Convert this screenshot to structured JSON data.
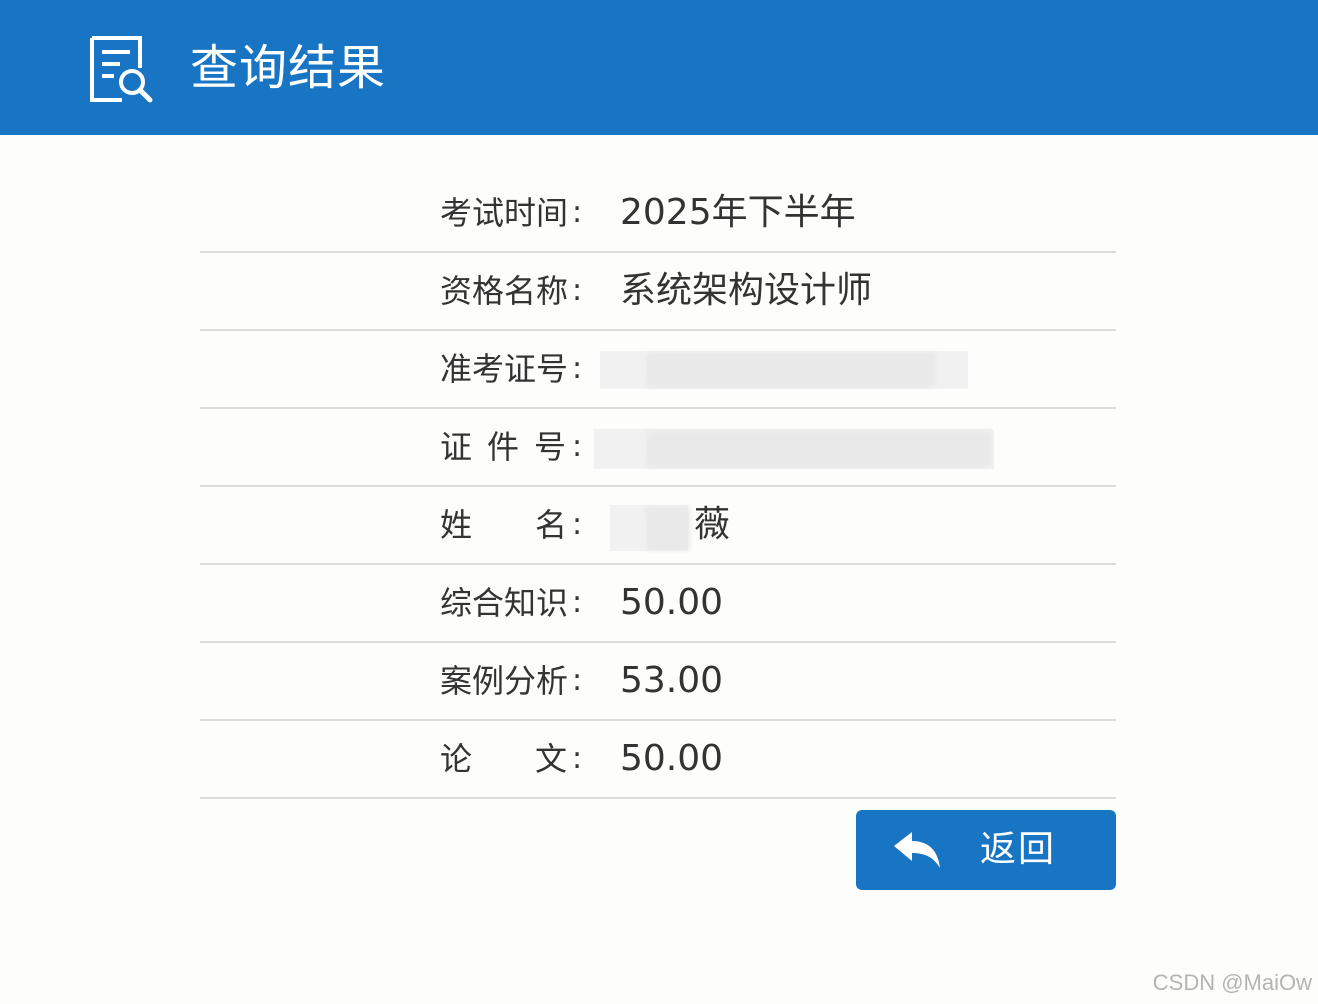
{
  "header": {
    "title": "查询结果",
    "icon": "document-search-icon",
    "bg_color": "#1875c4"
  },
  "results": [
    {
      "label": "考试时间",
      "colon": ":",
      "value": "2025年下半年"
    },
    {
      "label": "资格名称",
      "colon": ":",
      "value": "系统架构设计师"
    },
    {
      "label": "准考证号",
      "colon": ":",
      "value": ""
    },
    {
      "label": "证件号",
      "colon": ":",
      "value": ""
    },
    {
      "label": "姓名",
      "colon": ":",
      "value": "薇"
    },
    {
      "label": "综合知识",
      "colon": ":",
      "value": "50.00"
    },
    {
      "label": "案例分析",
      "colon": ":",
      "value": "53.00"
    },
    {
      "label": "论文",
      "colon": ":",
      "value": "50.00"
    }
  ],
  "actions": {
    "return_label": "返回",
    "return_icon": "reply-arrow-icon"
  },
  "watermark": "CSDN @MaiOw"
}
